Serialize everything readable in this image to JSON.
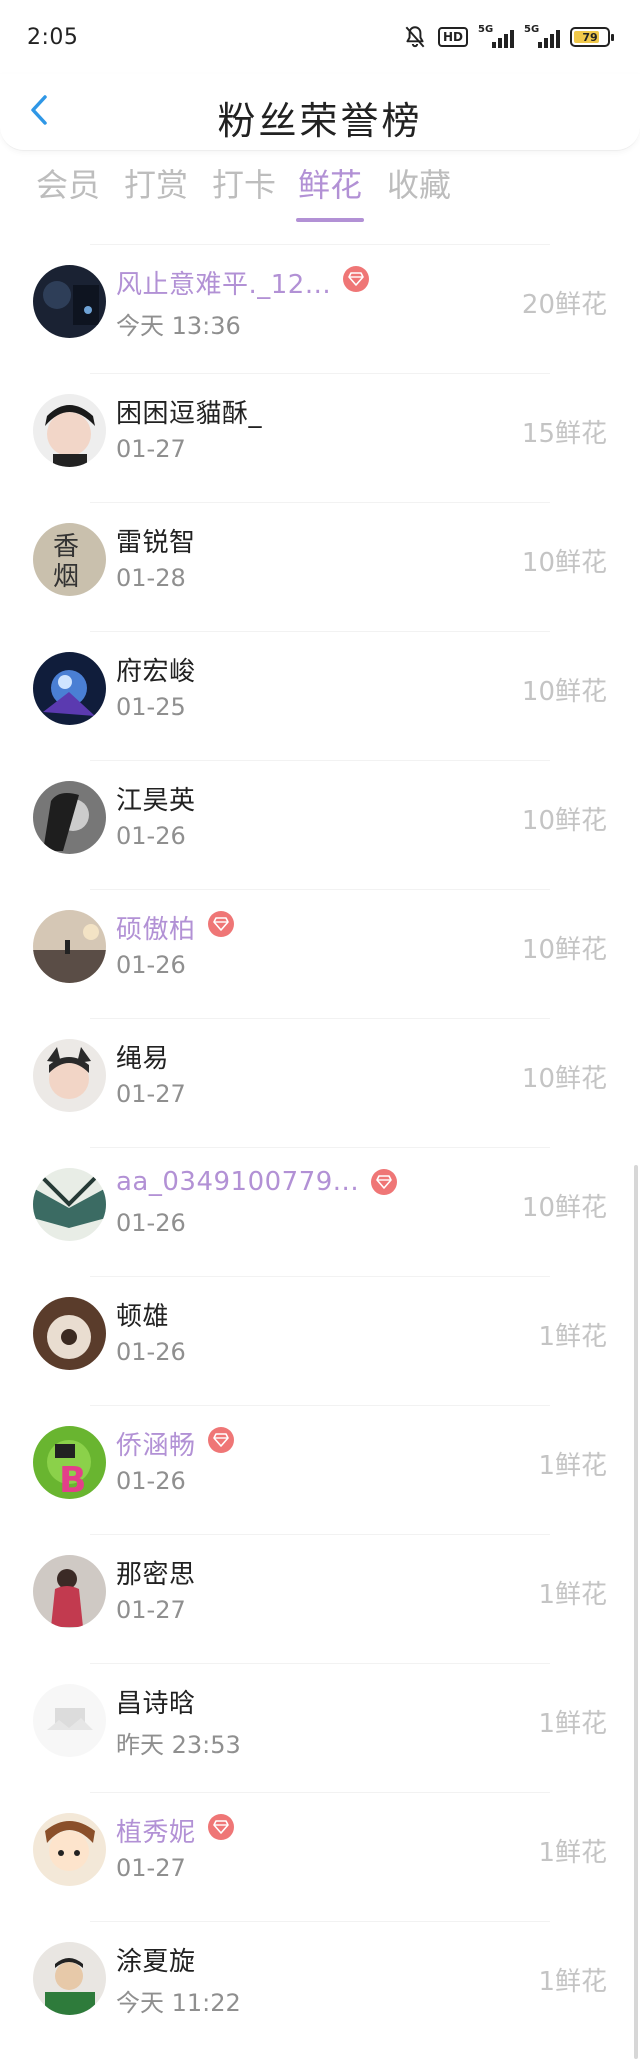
{
  "status_bar": {
    "time": "2:05",
    "network_a": "5G",
    "network_b": "5G",
    "hd_label": "HD",
    "battery": "79",
    "battery_level": 0.79
  },
  "header": {
    "title": "粉丝荣誉榜",
    "back_icon": "chevron-left-icon"
  },
  "tabs": [
    {
      "label": "会员",
      "active": false
    },
    {
      "label": "打赏",
      "active": false
    },
    {
      "label": "打卡",
      "active": false
    },
    {
      "label": "鲜花",
      "active": true
    },
    {
      "label": "收藏",
      "active": false
    }
  ],
  "fans": [
    {
      "name": "风止意难平._12...",
      "vip": true,
      "date": "今天 13:36",
      "flowers": "20鲜花"
    },
    {
      "name": "困困逗貓酥_",
      "vip": false,
      "date": "01-27",
      "flowers": "15鲜花"
    },
    {
      "name": "雷锐智",
      "vip": false,
      "date": "01-28",
      "flowers": "10鲜花"
    },
    {
      "name": "府宏峻",
      "vip": false,
      "date": "01-25",
      "flowers": "10鲜花"
    },
    {
      "name": "江昊英",
      "vip": false,
      "date": "01-26",
      "flowers": "10鲜花"
    },
    {
      "name": "硕傲柏",
      "vip": true,
      "date": "01-26",
      "flowers": "10鲜花"
    },
    {
      "name": "绳易",
      "vip": false,
      "date": "01-27",
      "flowers": "10鲜花"
    },
    {
      "name": "aa_0349100779...",
      "vip": true,
      "date": "01-26",
      "flowers": "10鲜花"
    },
    {
      "name": "顿雄",
      "vip": false,
      "date": "01-26",
      "flowers": "1鲜花"
    },
    {
      "name": "侨涵畅",
      "vip": true,
      "date": "01-26",
      "flowers": "1鲜花"
    },
    {
      "name": "那密思",
      "vip": false,
      "date": "01-27",
      "flowers": "1鲜花"
    },
    {
      "name": "昌诗晗",
      "vip": false,
      "date": "昨天 23:53",
      "flowers": "1鲜花"
    },
    {
      "name": "植秀妮",
      "vip": true,
      "date": "01-27",
      "flowers": "1鲜花"
    },
    {
      "name": "涂夏旋",
      "vip": false,
      "date": "今天 11:22",
      "flowers": "1鲜花"
    }
  ],
  "colors": {
    "accent": "#b291d5",
    "vip_badge": "#ef7676",
    "inactive_tab": "#bdbdbd",
    "date_text": "#8f8f8f",
    "flower_text": "#c4c4c4"
  }
}
